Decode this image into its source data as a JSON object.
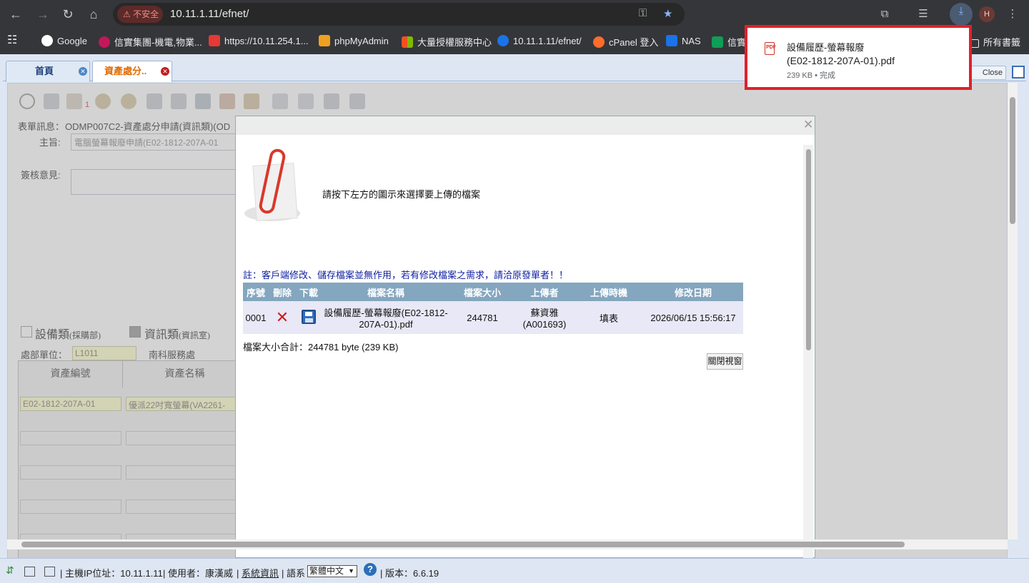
{
  "browser": {
    "security_label": "不安全",
    "url": "10.11.1.11/efnet/",
    "avatar_letter": "H",
    "icons": [
      "back-icon",
      "forward-icon",
      "reload-icon",
      "home-icon",
      "key-icon",
      "star-icon",
      "extensions-icon",
      "reading-list-icon",
      "download-icon",
      "menu-icon"
    ]
  },
  "bookmarks": {
    "items": [
      {
        "label": "Google",
        "color": "#ea4335"
      },
      {
        "label": "信實集團-機電,物業...",
        "color": "#c2185b"
      },
      {
        "label": "https://10.11.254.1...",
        "color": "#e53935"
      },
      {
        "label": "phpMyAdmin",
        "color": "#f0a020"
      },
      {
        "label": "大量授權服務中心",
        "color": "#f25022"
      },
      {
        "label": "10.11.1.11/efnet/",
        "color": "#1a73e8"
      },
      {
        "label": "cPanel 登入",
        "color": "#ff6c2c"
      },
      {
        "label": "NAS",
        "color": "#1a73e8"
      },
      {
        "label": "信實",
        "color": "#0f9d58"
      }
    ],
    "all_bookmarks": "所有書籤"
  },
  "download_popup": {
    "filename_line1": "設備履歷-螢幕報廢",
    "filename_line2": "(E02-1812-207A-01).pdf",
    "meta": "239 KB • 完成"
  },
  "tabs": {
    "home": "首頁",
    "asset": "資產處分..",
    "close_tab": "Close Tab"
  },
  "form": {
    "info_label": "表單訊息：",
    "info_value": "ODMP007C2-資產處分申請(資訊類)(OD",
    "subject_label": "主旨:",
    "subject_value": "電腦螢幕報廢申請(E02-1812-207A-01",
    "review_label": "簽核意見:",
    "attach_count": "1",
    "cat_equipment": "設備類",
    "cat_equipment_sub": "(採購部)",
    "cat_it": "資訊類",
    "cat_it_sub": "(資訊室)",
    "dept_label": "處部單位：",
    "dept_code": "L1011",
    "dept_name": "南科服務處",
    "col_asset_no": "資產編號",
    "col_asset_name": "資產名稱",
    "asset_no_1": "E02-1812-207A-01",
    "asset_name_1": "優派22吋寬螢幕(VA2261-"
  },
  "dialog": {
    "instruction": "請按下左方的圖示來選擇要上傳的檔案",
    "note": "註：客戶端修改、儲存檔案並無作用，若有修改檔案之需求，請洽原發單者！！",
    "columns": [
      "序號",
      "刪除",
      "下載",
      "檔案名稱",
      "檔案大小",
      "上傳者",
      "上傳時機",
      "修改日期"
    ],
    "row": {
      "seq": "0001",
      "filename": "設備履歷-螢幕報廢(E02-1812-207A-01).pdf",
      "size": "244781",
      "uploader": "蘇資雅(A001693)",
      "timing": "填表",
      "modified": "2026/06/15 15:56:17"
    },
    "total": "檔案大小合計：244781 byte (239 KB)",
    "close_button": "關閉視窗"
  },
  "statusbar": {
    "host_label": "主機IP位址：10.11.1.11",
    "user_label": "使用者：康漢威",
    "sysinfo": "系統資訊",
    "lang_label": "語系",
    "lang_value": "繁體中文",
    "version": "版本：6.6.19"
  }
}
